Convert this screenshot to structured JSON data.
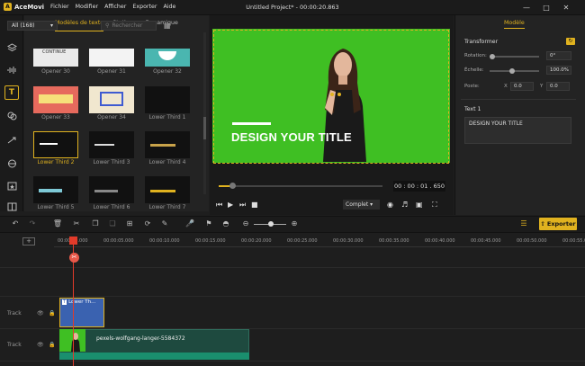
{
  "app": {
    "name": "AceMovi",
    "doc_title": "Untitled Project* - 00:00:20.863"
  },
  "menu": [
    "Fichier",
    "Modifier",
    "Afficher",
    "Exporter",
    "Aide"
  ],
  "media": {
    "tabs": [
      "Modèles de texte",
      "Statique",
      "Dynamique"
    ],
    "filter": "All (168)",
    "search_placeholder": "Rechercher",
    "thumbs": [
      "Opener 30",
      "Opener 31",
      "Opener 32",
      "Opener 33",
      "Opener 34",
      "Lower Third 1",
      "Lower Third 2",
      "Lower Third 3",
      "Lower Third 4",
      "Lower Third 5",
      "Lower Third 6",
      "Lower Third 7"
    ]
  },
  "preview": {
    "title_text": "DESIGN YOUR TITLE",
    "timecode": "00 : 00 : 01 . 650",
    "quality": "Complet",
    "progress": 0.06
  },
  "props": {
    "tab": "Modèle",
    "section": "Transformer",
    "rotation_label": "Rotation:",
    "rotation_value": "0°",
    "scale_label": "Échelle:",
    "scale_value": "100.0%",
    "position_label": "Poste:",
    "x_label": "X",
    "x_value": "0.0",
    "y_label": "Y",
    "y_value": "0.0",
    "text_section": "Text 1",
    "text_value": "DESIGN YOUR TITLE"
  },
  "toolbar": {
    "export_label": "Exporter"
  },
  "timeline": {
    "ticks": [
      "00:00:00.000",
      "00:00:05.000",
      "00:00:10.000",
      "00:00:15.000",
      "00:00:20.000",
      "00:00:25.000",
      "00:00:30.000",
      "00:00:35.000",
      "00:00:40.000",
      "00:00:45.000",
      "00:00:50.000",
      "00:00:55.000"
    ],
    "track_label": "Track",
    "title_clip": "Lower Th...",
    "video_clip": "pexels-wolfgang-langer-5584372"
  },
  "colors": {
    "accent": "#e0b21f",
    "green_screen": "#3fbf23",
    "playhead": "#e23b2a",
    "title_clip": "#3a62b0",
    "video_clip": "#1e4a3f"
  }
}
